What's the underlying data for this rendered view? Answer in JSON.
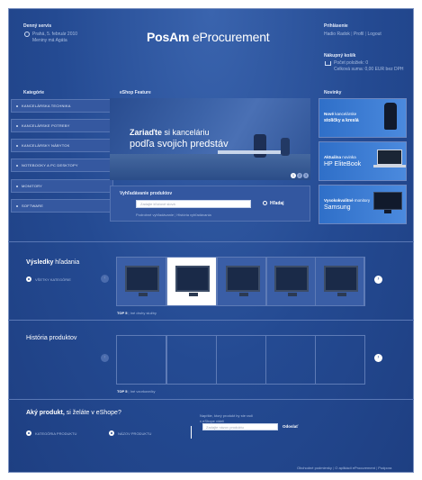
{
  "service": {
    "title": "Denný servis",
    "date": "Prahá, 5. február 2010",
    "subtitle": "Meniny má Agáta"
  },
  "logo": {
    "brand": "PosAm",
    "product": " eProcurement"
  },
  "login": {
    "title": "Prihlásenie",
    "user": "Hadio Radok",
    "separator": "|",
    "links": [
      "Profil",
      "Logout"
    ]
  },
  "cart": {
    "title": "Nákupný košík",
    "items_label": "Počet položiek:",
    "items_value": "0",
    "total_label": "Celková suma:",
    "total_value": "0,00 EUR bez DPH"
  },
  "categories": {
    "title": "Kategórie",
    "items": [
      "KANCELÁRSKA TECHNIKA",
      "KANCELÁRSKE POTREBY",
      "KANCELÁRSKY NÁBYTOK",
      "NOTEBOOKY A PC DESKTOPY",
      "MONITORY",
      "SOFTWARE"
    ]
  },
  "feature": {
    "title": "eShop Feature",
    "line1_strong": "Zariaďte",
    "line1_rest": " si kanceláriu",
    "line2": "podľa svojich predstáv",
    "pages": [
      "1",
      "2",
      "3"
    ]
  },
  "search": {
    "title": "Vyhľadávanie produktov",
    "placeholder": "Zadajte kľúčové slová",
    "button": "Hľadaj",
    "links": [
      "Podrobné vyhľadávanie",
      "História vyhľadávania"
    ]
  },
  "news": {
    "title": "Novinky",
    "items": [
      {
        "strong": "Nové",
        "rest": " kancelárske",
        "line2": "stoličky a kreslá"
      },
      {
        "strong": "Aktuálna",
        "rest": " novinka",
        "line2": "HP EliteBook"
      },
      {
        "strong": "Vysokokvalitné",
        "rest": " monitory",
        "line2": "Samsung"
      }
    ]
  },
  "results": {
    "title_strong": "Výsledky",
    "title_rest": " hľadania",
    "filter": "VŠETKY KATEGÓRIE",
    "footer_top": "TOP 5",
    "footer_link": "Iné druhy služby"
  },
  "history": {
    "title": "História produktov",
    "footer_top": "TOP 5",
    "footer_link": "Iné vzorkovníky"
  },
  "wish": {
    "title_strong": "Aký produkt,",
    "title_rest": " si želáte v eShope?",
    "option1": "KATEGÓRIA PRODUKTU",
    "option2": "NÁZOV PRODUKTU",
    "hint1": "Napíšte, ktorý produkt by ste radi",
    "hint2": "v eShope videli",
    "placeholder": "Zadajte názov produktu",
    "submit": "Odoslať"
  },
  "footer": {
    "links": [
      "Obchodné podmienky",
      "O aplikácii eProcurement",
      "Podpora"
    ],
    "separator": "|"
  },
  "colors": {
    "background": "#244a92",
    "panel": "#3357a0",
    "accent_white": "#ffffff"
  }
}
